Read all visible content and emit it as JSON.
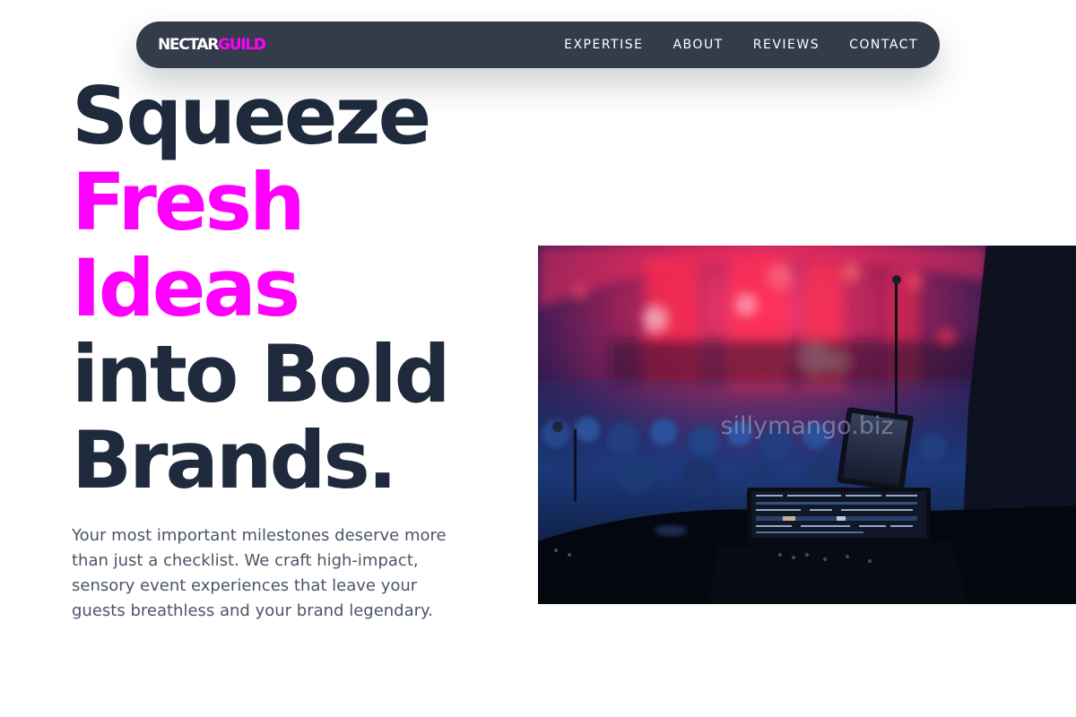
{
  "nav": {
    "logo_primary": "NECTAR",
    "logo_accent": "GUILD",
    "links": [
      "EXPERTISE",
      "ABOUT",
      "REVIEWS",
      "CONTACT"
    ]
  },
  "hero": {
    "headline": {
      "line1": "Squeeze",
      "line2": "Fresh",
      "line3": "Ideas",
      "line4": "into Bold",
      "line5": "Brands."
    },
    "description": "Your most important milestones deserve more than just a checklist. We craft high-impact, sensory event experiences that leave your guests breathless and your brand legendary.",
    "image_watermark": "sillymango.biz"
  },
  "colors": {
    "accent": "#ff00ff",
    "heading": "#1f2a3c",
    "nav_background": "#343c4c",
    "body_text": "#4b5568"
  }
}
